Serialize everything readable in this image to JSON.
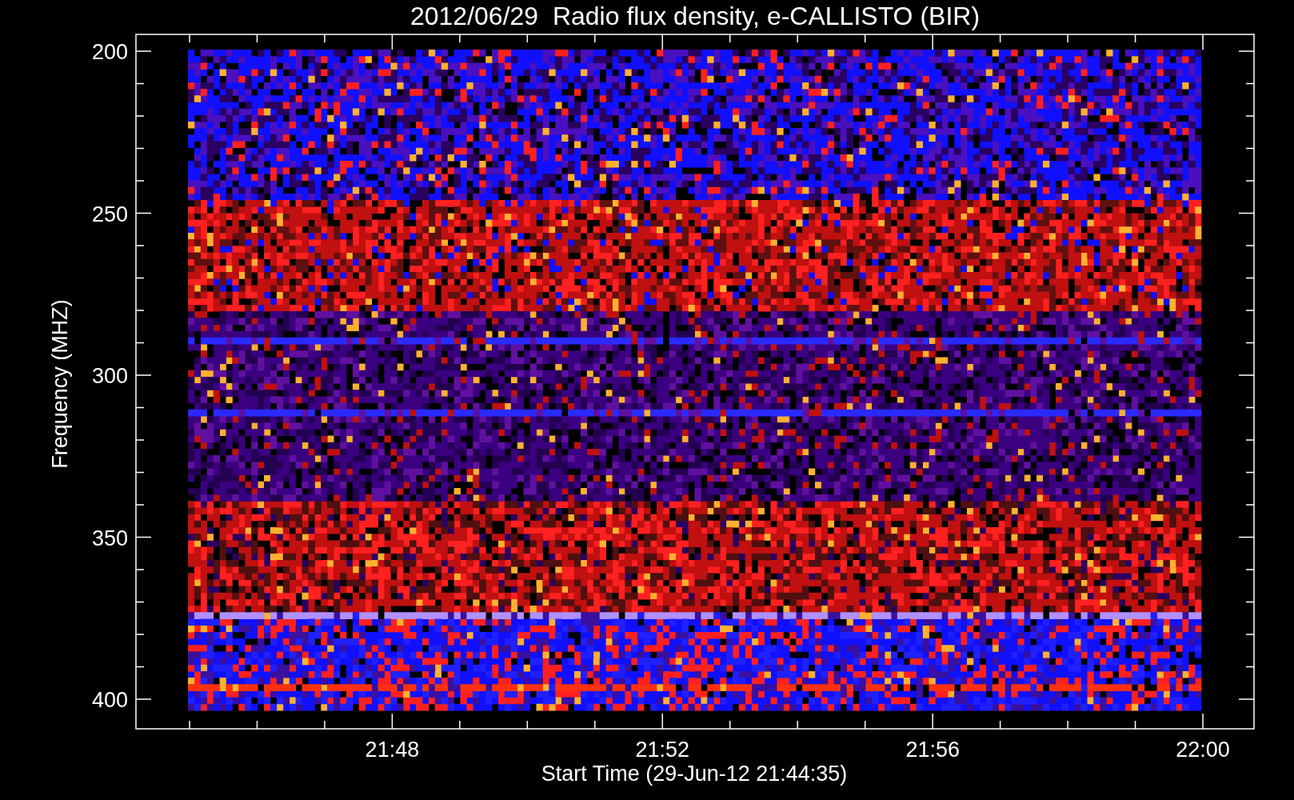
{
  "title": "2012/06/29  Radio flux density, e-CALLISTO (BIR)",
  "y_axis": {
    "label": "Frequency (MHZ)",
    "ticks": [
      "200",
      "250",
      "300",
      "350",
      "400"
    ]
  },
  "x_axis": {
    "label": "Start Time (29-Jun-12 21:44:35)",
    "ticks": [
      "21:48",
      "21:52",
      "21:56",
      "22:00"
    ]
  }
}
